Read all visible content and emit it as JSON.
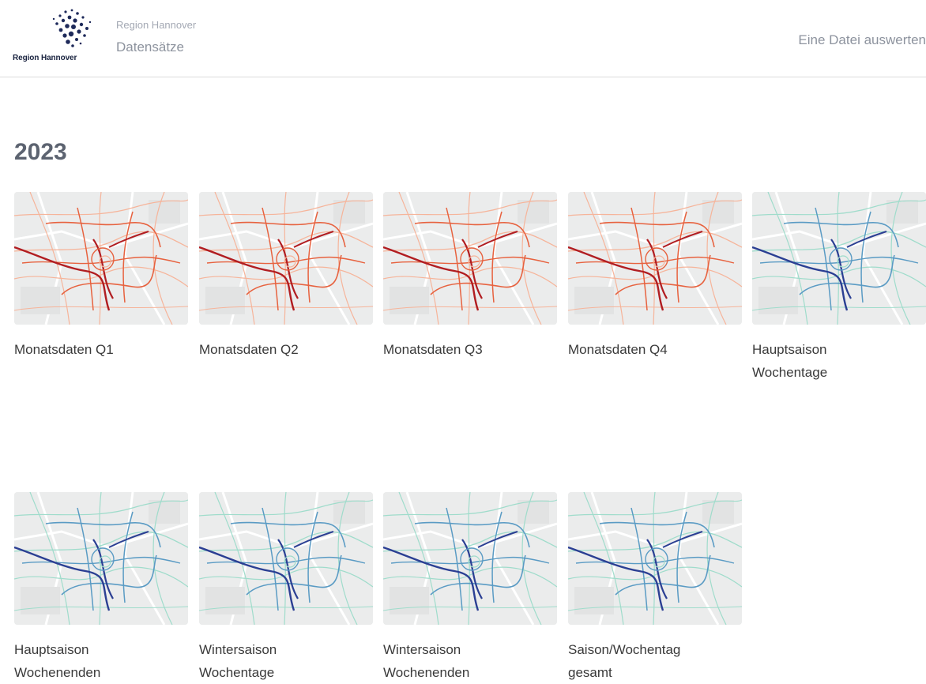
{
  "header": {
    "logo_text": "Region Hannover",
    "crumb_top": "Region Hannover",
    "crumb_main": "Datensätze",
    "action_link": "Eine Datei auswerten"
  },
  "section": {
    "title": "2023",
    "datasets": [
      {
        "line1": "Monatsdaten Q1",
        "line2": "",
        "theme": "red"
      },
      {
        "line1": "Monatsdaten Q2",
        "line2": "",
        "theme": "red"
      },
      {
        "line1": "Monatsdaten Q3",
        "line2": "",
        "theme": "red"
      },
      {
        "line1": "Monatsdaten Q4",
        "line2": "",
        "theme": "red"
      },
      {
        "line1": "Hauptsaison",
        "line2": "Wochentage",
        "theme": "blue"
      },
      {
        "line1": "Hauptsaison",
        "line2": "Wochenenden",
        "theme": "blue"
      },
      {
        "line1": "Wintersaison",
        "line2": "Wochentage",
        "theme": "blue"
      },
      {
        "line1": "Wintersaison",
        "line2": "Wochenenden",
        "theme": "blue"
      },
      {
        "line1": "Saison/Wochentag",
        "line2": "gesamt",
        "theme": "blue"
      }
    ]
  },
  "colors": {
    "red_light": "#f6b49a",
    "red_mid": "#e7623f",
    "red_dark": "#b11d21",
    "blue_light": "#9fdccb",
    "blue_mid": "#5a9bc4",
    "blue_dark": "#2b3f93"
  }
}
